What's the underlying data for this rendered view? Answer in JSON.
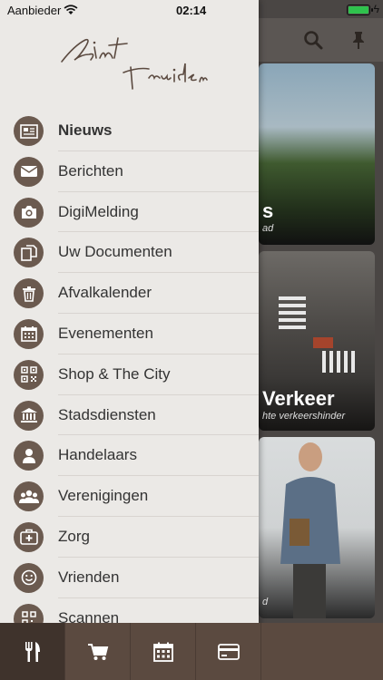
{
  "status_bar": {
    "carrier": "Aanbieder",
    "time": "02:14",
    "battery_level": 0.9
  },
  "logo_text": "Sint Truiden",
  "menu": {
    "items": [
      {
        "label": "Nieuws",
        "icon": "newspaper-icon",
        "active": true
      },
      {
        "label": "Berichten",
        "icon": "envelope-icon",
        "active": false
      },
      {
        "label": "DigiMelding",
        "icon": "camera-icon",
        "active": false
      },
      {
        "label": "Uw Documenten",
        "icon": "documents-icon",
        "active": false
      },
      {
        "label": "Afvalkalender",
        "icon": "trash-icon",
        "active": false
      },
      {
        "label": "Evenementen",
        "icon": "calendar-icon",
        "active": false
      },
      {
        "label": "Shop & The City",
        "icon": "qr-code-icon",
        "active": false
      },
      {
        "label": "Stadsdiensten",
        "icon": "townhall-icon",
        "active": false
      },
      {
        "label": "Handelaars",
        "icon": "person-icon",
        "active": false
      },
      {
        "label": "Verenigingen",
        "icon": "group-icon",
        "active": false
      },
      {
        "label": "Zorg",
        "icon": "first-aid-icon",
        "active": false
      },
      {
        "label": "Vrienden",
        "icon": "smiley-icon",
        "active": false
      },
      {
        "label": "Scannen",
        "icon": "qr-scan-icon",
        "active": false
      }
    ]
  },
  "background_cards": [
    {
      "title": "s",
      "subtitle": "ad"
    },
    {
      "title": "Verkeer",
      "subtitle": "hte verkeershinder"
    },
    {
      "title": "",
      "subtitle": "d"
    }
  ],
  "tabbar": {
    "tabs": [
      {
        "icon": "fork-knife-icon",
        "active": true
      },
      {
        "icon": "cart-icon",
        "active": false
      },
      {
        "icon": "calendar-icon",
        "active": false
      },
      {
        "icon": "credit-card-icon",
        "active": false
      }
    ]
  },
  "colors": {
    "drawer_bg": "#ebe9e6",
    "icon_circle": "#6b5a4f",
    "tabbar_bg": "#5b4a40",
    "tab_active": "#3f332c"
  }
}
